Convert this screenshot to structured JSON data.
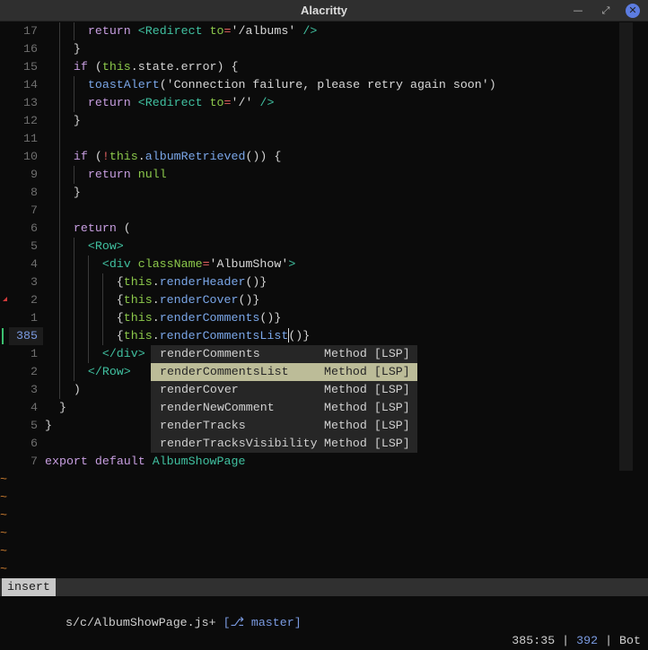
{
  "window": {
    "title": "Alacritty",
    "minimize": "—",
    "maximize": "⤢",
    "close": "✕"
  },
  "editor": {
    "lines": [
      {
        "n": "17",
        "indent": 3,
        "tokens": [
          [
            "      ",
            "p"
          ],
          [
            "return",
            "kw"
          ],
          [
            " ",
            "p"
          ],
          [
            "<Redirect",
            "tag"
          ],
          [
            " to",
            "th"
          ],
          [
            "=",
            "op"
          ],
          [
            "'/albums'",
            "str"
          ],
          [
            " />",
            "tag"
          ]
        ]
      },
      {
        "n": "16",
        "indent": 2,
        "tokens": [
          [
            "    }",
            "p"
          ]
        ]
      },
      {
        "n": "15",
        "indent": 2,
        "tokens": [
          [
            "    ",
            "p"
          ],
          [
            "if",
            "kw"
          ],
          [
            " (",
            "p"
          ],
          [
            "this",
            "th"
          ],
          [
            ".state.error) {",
            "p"
          ]
        ]
      },
      {
        "n": "14",
        "indent": 3,
        "tokens": [
          [
            "      ",
            "p"
          ],
          [
            "toastAlert",
            "fn"
          ],
          [
            "(",
            "p"
          ],
          [
            "'Connection failure, please retry again soon'",
            "str"
          ],
          [
            ")",
            "p"
          ]
        ]
      },
      {
        "n": "13",
        "indent": 3,
        "tokens": [
          [
            "      ",
            "p"
          ],
          [
            "return",
            "kw"
          ],
          [
            " ",
            "p"
          ],
          [
            "<Redirect",
            "tag"
          ],
          [
            " to",
            "th"
          ],
          [
            "=",
            "op"
          ],
          [
            "'/'",
            "str"
          ],
          [
            " />",
            "tag"
          ]
        ]
      },
      {
        "n": "12",
        "indent": 2,
        "tokens": [
          [
            "    }",
            "p"
          ]
        ]
      },
      {
        "n": "11",
        "indent": 2,
        "tokens": []
      },
      {
        "n": "10",
        "indent": 2,
        "tokens": [
          [
            "    ",
            "p"
          ],
          [
            "if",
            "kw"
          ],
          [
            " (",
            "p"
          ],
          [
            "!",
            "op"
          ],
          [
            "this",
            "th"
          ],
          [
            ".",
            "p"
          ],
          [
            "albumRetrieved",
            "fn"
          ],
          [
            "()) {",
            "p"
          ]
        ]
      },
      {
        "n": "9",
        "indent": 3,
        "tokens": [
          [
            "      ",
            "p"
          ],
          [
            "return",
            "kw"
          ],
          [
            " ",
            "p"
          ],
          [
            "null",
            "th"
          ]
        ]
      },
      {
        "n": "8",
        "indent": 2,
        "tokens": [
          [
            "    }",
            "p"
          ]
        ]
      },
      {
        "n": "7",
        "indent": 2,
        "tokens": []
      },
      {
        "n": "6",
        "indent": 2,
        "tokens": [
          [
            "    ",
            "p"
          ],
          [
            "return",
            "kw"
          ],
          [
            " (",
            "p"
          ]
        ]
      },
      {
        "n": "5",
        "indent": 3,
        "tokens": [
          [
            "      ",
            "p"
          ],
          [
            "<Row>",
            "tag"
          ]
        ]
      },
      {
        "n": "4",
        "indent": 4,
        "tokens": [
          [
            "        ",
            "p"
          ],
          [
            "<div",
            "tag"
          ],
          [
            " className",
            "th"
          ],
          [
            "=",
            "op"
          ],
          [
            "'AlbumShow'",
            "str"
          ],
          [
            ">",
            "tag"
          ]
        ]
      },
      {
        "n": "3",
        "indent": 5,
        "tokens": [
          [
            "          {",
            "p"
          ],
          [
            "this",
            "th"
          ],
          [
            ".",
            "p"
          ],
          [
            "renderHeader",
            "fn"
          ],
          [
            "()}",
            "p"
          ]
        ]
      },
      {
        "n": "2",
        "indent": 5,
        "sign": "warn",
        "tokens": [
          [
            "          {",
            "p"
          ],
          [
            "this",
            "th"
          ],
          [
            ".",
            "p"
          ],
          [
            "renderCover",
            "fn"
          ],
          [
            "()}",
            "p"
          ]
        ]
      },
      {
        "n": "1",
        "indent": 5,
        "tokens": [
          [
            "          {",
            "p"
          ],
          [
            "this",
            "th"
          ],
          [
            ".",
            "p"
          ],
          [
            "renderComments",
            "fn"
          ],
          [
            "()}",
            "p"
          ]
        ]
      },
      {
        "n": "385",
        "indent": 5,
        "current": true,
        "sign": "add",
        "tokens": [
          [
            "          {",
            "p"
          ],
          [
            "this",
            "th"
          ],
          [
            ".",
            "p"
          ],
          [
            "renderCommentsList",
            "fn"
          ],
          [
            "|",
            "cursor"
          ],
          [
            "()}",
            "p"
          ]
        ]
      },
      {
        "n": "1",
        "indent": 4,
        "tokens": [
          [
            "        ",
            "p"
          ],
          [
            "</div>",
            "tag"
          ]
        ]
      },
      {
        "n": "2",
        "indent": 3,
        "tokens": [
          [
            "      ",
            "p"
          ],
          [
            "</Row>",
            "tag"
          ]
        ]
      },
      {
        "n": "3",
        "indent": 2,
        "tokens": [
          [
            "    )",
            "p"
          ]
        ]
      },
      {
        "n": "4",
        "indent": 1,
        "tokens": [
          [
            "  }",
            "p"
          ]
        ]
      },
      {
        "n": "5",
        "indent": 0,
        "tokens": [
          [
            "}",
            "p"
          ]
        ]
      },
      {
        "n": "6",
        "indent": 0,
        "tokens": []
      },
      {
        "n": "7",
        "indent": 0,
        "tokens": [
          [
            "export",
            "kw"
          ],
          [
            " ",
            "p"
          ],
          [
            "default",
            "kw"
          ],
          [
            " ",
            "p"
          ],
          [
            "AlbumShowPage",
            "tag"
          ]
        ]
      }
    ],
    "tilde": "~",
    "tilde_count": 6
  },
  "completion": {
    "selected_index": 1,
    "items": [
      {
        "name": "renderComments",
        "kind": "Method [LSP]"
      },
      {
        "name": "renderCommentsList",
        "kind": "Method [LSP]"
      },
      {
        "name": "renderCover",
        "kind": "Method [LSP]"
      },
      {
        "name": "renderNewComment",
        "kind": "Method [LSP]"
      },
      {
        "name": "renderTracks",
        "kind": "Method [LSP]"
      },
      {
        "name": "renderTracksVisibility",
        "kind": "Method [LSP]"
      }
    ]
  },
  "statusline": {
    "mode": "insert",
    "file": "s/c/AlbumShowPage.js+ ",
    "branch": "[⎇ master]",
    "position": "385:35",
    "sep": " | ",
    "total": "392",
    "scroll": "Bot"
  }
}
